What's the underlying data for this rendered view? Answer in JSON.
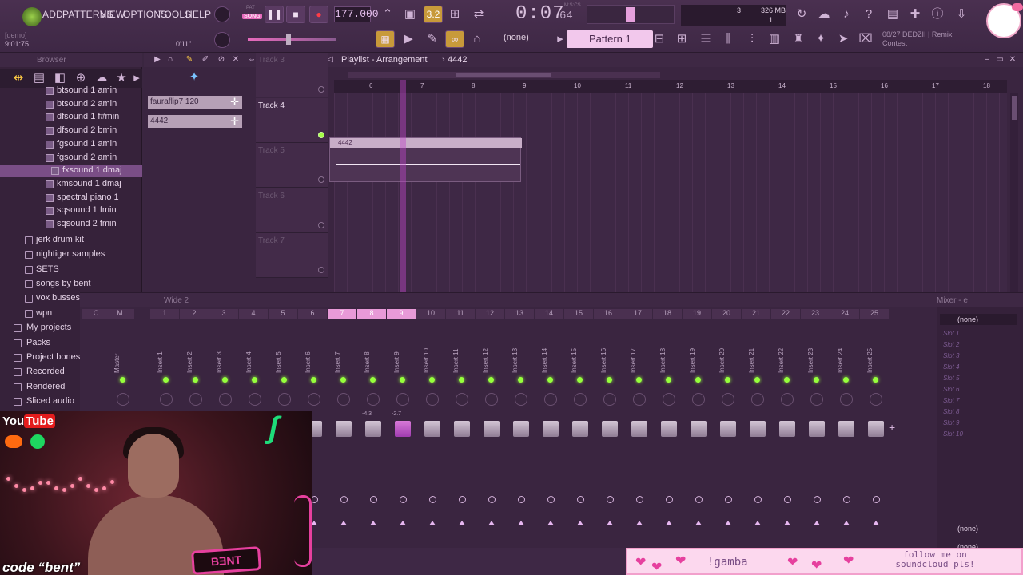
{
  "menu": [
    "ADD",
    "PATTERNS",
    "VIEW",
    "OPTIONS",
    "TOOLS",
    "HELP"
  ],
  "transport": {
    "mode_song": "SONG",
    "mode_pat": "PAT",
    "tempo": "177.000",
    "timer": "0:07",
    "timer_sub": "64",
    "mst": "M:S:CS",
    "cpu": "326 MB",
    "cpu_num1": "3",
    "cpu_num2": "1",
    "snap": "3.2"
  },
  "info": {
    "demo_label": "[demo]",
    "time_left": "9:01:75",
    "time_right": "0'11\""
  },
  "pattern": {
    "none_label": "(none)",
    "name": "Pattern 1"
  },
  "hint": {
    "date": "08/27",
    "text1": "DEDZII | Remix",
    "text2": "Contest"
  },
  "browser": {
    "title": "Browser",
    "subitems": [
      {
        "label": "btsound 1 amin"
      },
      {
        "label": "btsound 2 amin"
      },
      {
        "label": "dfsound 1 f#min"
      },
      {
        "label": "dfsound 2 bmin"
      },
      {
        "label": "fgsound 1 amin"
      },
      {
        "label": "fgsound 2 amin"
      },
      {
        "label": "fxsound 1 dmaj",
        "selected": true
      },
      {
        "label": "kmsound 1 dmaj"
      },
      {
        "label": "spectral piano 1"
      },
      {
        "label": "sqsound 1 fmin"
      },
      {
        "label": "sqsound 2 fmin"
      }
    ],
    "folders": [
      "jerk drum kit",
      "nightiger samples",
      "SETS",
      "songs by bent",
      "vox busses",
      "wpn"
    ],
    "roots": [
      "My projects",
      "Packs",
      "Project bones",
      "Recorded",
      "Rendered",
      "Sliced audio"
    ]
  },
  "playlist": {
    "title": "Playlist - Arrangement",
    "pattern_name": "4442",
    "patterns": [
      "fauraflip7 120",
      "4442"
    ],
    "tracks": [
      {
        "name": "Track 3",
        "active": false
      },
      {
        "name": "Track 4",
        "active": true
      },
      {
        "name": "Track 5",
        "active": false
      },
      {
        "name": "Track 6",
        "active": false
      },
      {
        "name": "Track 7",
        "active": false
      }
    ],
    "ruler": [
      "6",
      "7",
      "8",
      "9",
      "10",
      "11",
      "12",
      "13",
      "14",
      "15",
      "16",
      "17",
      "18"
    ],
    "clip_label": "4442"
  },
  "mixer": {
    "title": "Wide 2",
    "panel_title": "Mixer - e",
    "numbers": [
      "C",
      "M",
      "1",
      "2",
      "3",
      "4",
      "5",
      "6",
      "7",
      "8",
      "9",
      "10",
      "11",
      "12",
      "13",
      "14",
      "15",
      "16",
      "17",
      "18",
      "19",
      "20",
      "21",
      "22",
      "23",
      "24",
      "25"
    ],
    "inserts": [
      "Master",
      "Insert 1",
      "Insert 2",
      "Insert 3",
      "Insert 4",
      "Insert 5",
      "Insert 6",
      "Insert 7",
      "Insert 8",
      "Insert 9",
      "Insert 10",
      "Insert 11",
      "Insert 12",
      "Insert 13",
      "Insert 14",
      "Insert 15",
      "Insert 16",
      "Insert 17",
      "Insert 18",
      "Insert 19",
      "Insert 20",
      "Insert 21",
      "Insert 22",
      "Insert 23",
      "Insert 24",
      "Insert 25"
    ],
    "db_values": [
      "-4.3",
      "-2.7"
    ],
    "slots_header": "(none)",
    "slots": [
      "Slot 1",
      "Slot 2",
      "Slot 3",
      "Slot 4",
      "Slot 5",
      "Slot 6",
      "Slot 7",
      "Slot 8",
      "Slot 9",
      "Slot 10"
    ],
    "bottom_none_1": "(none)",
    "bottom_none_2": "(none)"
  },
  "overlay": {
    "youtube_you": "You",
    "youtube_tube": "Tube",
    "code_text": "code “bent”",
    "bent_logo": "BƎNT",
    "banner_text": "!gamba",
    "banner_follow": "follow me on soundcloud pls!"
  },
  "colors": {
    "accent": "#e89ad8",
    "led": "#96ff3c",
    "bg": "#3a2640"
  }
}
